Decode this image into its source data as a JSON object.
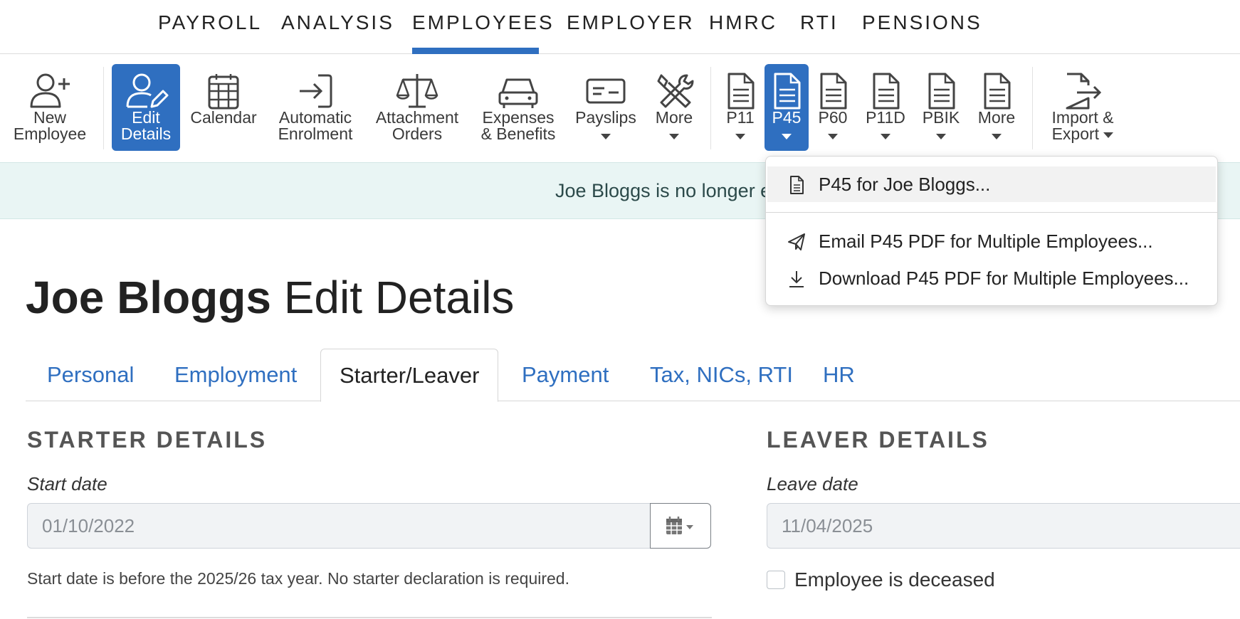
{
  "topnav": {
    "items": [
      "PAYROLL",
      "ANALYSIS",
      "EMPLOYEES",
      "EMPLOYER",
      "HMRC",
      "RTI",
      "PENSIONS"
    ],
    "active": "EMPLOYEES"
  },
  "toolbar": {
    "new_employee": [
      "New",
      "Employee"
    ],
    "edit_details": [
      "Edit",
      "Details"
    ],
    "calendar": "Calendar",
    "auto_enrolment": [
      "Automatic",
      "Enrolment"
    ],
    "attachment_orders": [
      "Attachment",
      "Orders"
    ],
    "expenses_benefits": [
      "Expenses",
      "& Benefits"
    ],
    "payslips": "Payslips",
    "more1": "More",
    "p11": "P11",
    "p45": "P45",
    "p60": "P60",
    "p11d": "P11D",
    "pbik": "PBIK",
    "more2": "More",
    "import_export": [
      "Import &",
      "Export"
    ]
  },
  "banner": {
    "text": "Joe Bloggs is no longer e"
  },
  "title": {
    "name": "Joe Bloggs",
    "rest": " Edit Details"
  },
  "tabs": [
    "Personal",
    "Employment",
    "Starter/Leaver",
    "Payment",
    "Tax, NICs, RTI",
    "HR"
  ],
  "active_tab": "Starter/Leaver",
  "starter": {
    "heading": "STARTER DETAILS",
    "start_date_label": "Start date",
    "start_date_value": "01/10/2022",
    "help": "Start date is before the 2025/26 tax year. No starter declaration is required."
  },
  "leaver": {
    "heading": "LEAVER DETAILS",
    "leave_date_label": "Leave date",
    "leave_date_value": "11/04/2025",
    "deceased_label": "Employee is deceased"
  },
  "dropdown": {
    "items": [
      "P45 for Joe Bloggs...",
      "Email P45 PDF for Multiple Employees...",
      "Download P45 PDF for Multiple Employees..."
    ]
  },
  "colors": {
    "accent": "#2f6fc0",
    "banner_bg": "#e9f5f4"
  }
}
